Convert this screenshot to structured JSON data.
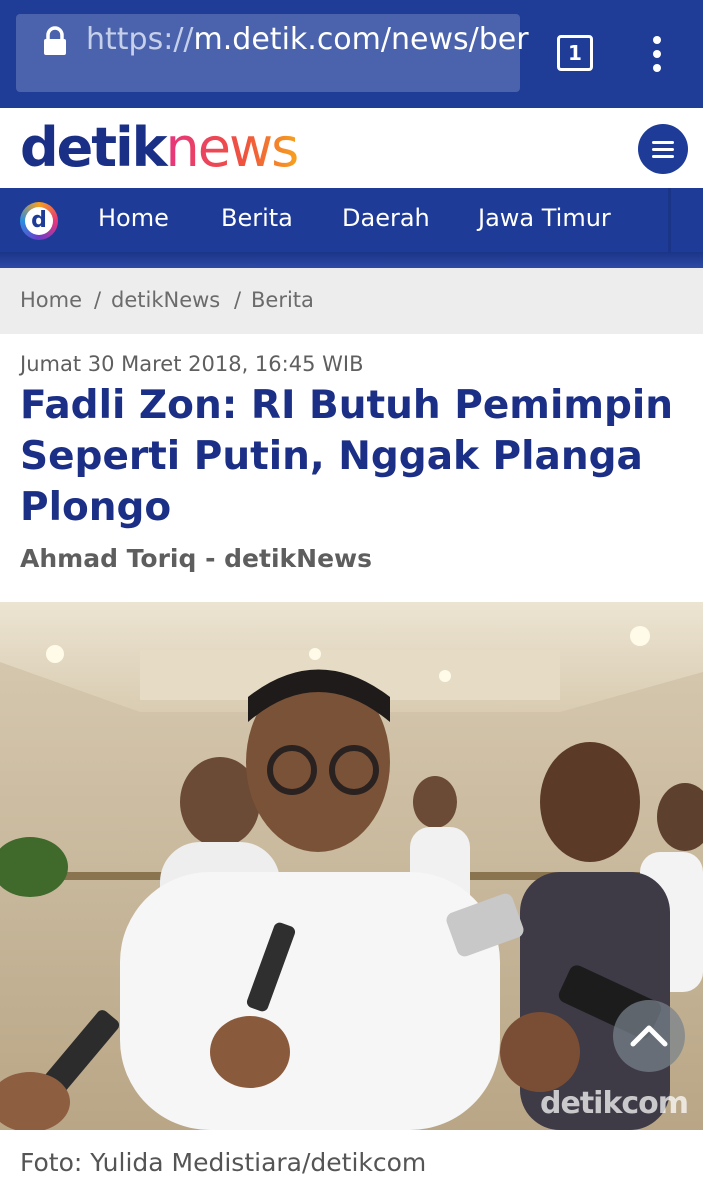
{
  "browser": {
    "url_scheme": "https://",
    "url_rest": "m.detik.com/news/ber",
    "tab_count": "1",
    "icons": [
      "lock-icon",
      "tabs-icon",
      "overflow-menu-icon"
    ]
  },
  "site": {
    "logo_detik": "detik",
    "logo_news": "news",
    "nav_logo_letter": "d",
    "nav": [
      "Home",
      "Berita",
      "Daerah",
      "Jawa Timur"
    ],
    "brand_color": "#1e3b97"
  },
  "breadcrumb": {
    "items": [
      "Home",
      "detikNews",
      "Berita"
    ],
    "separator": "/"
  },
  "article": {
    "date": "Jumat 30 Maret 2018, 16:45 WIB",
    "title": "Fadli Zon: RI Butuh Pemimpin Seperti Putin, Nggak Planga Plongo",
    "author": "Ahmad Toriq - detikNews",
    "photo_watermark": "detikcom",
    "caption": "Foto: Yulida Medistiara/detikcom"
  }
}
